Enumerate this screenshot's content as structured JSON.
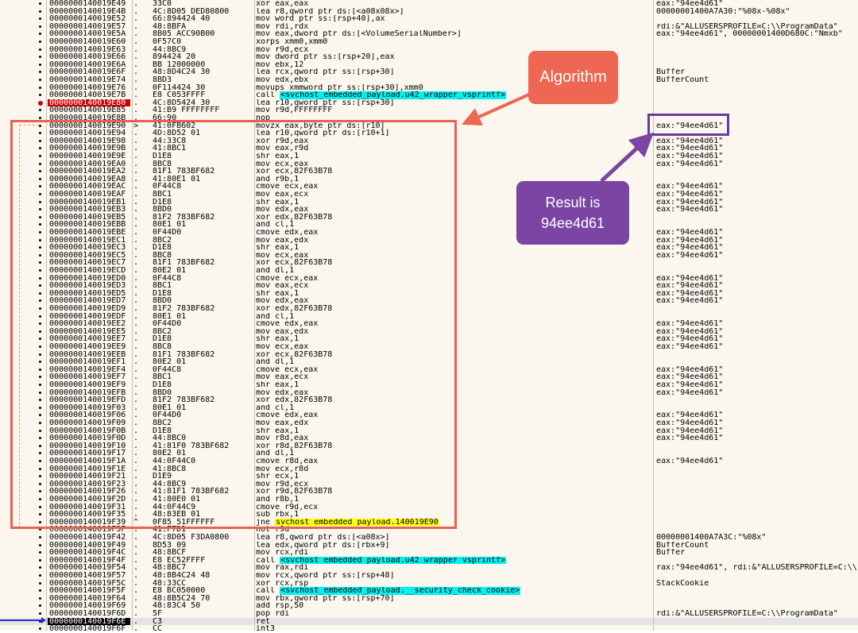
{
  "annotations": {
    "algorithm_label": "Algorithm",
    "result_line1": "Result is",
    "result_line2": "94ee4d61",
    "colors": {
      "algorithm": "#ee6752",
      "result": "#7a45a3",
      "call_highlight": "#00f0f0",
      "jump_highlight": "#ffff00",
      "breakpoint": "#cc0000"
    }
  },
  "rows": [
    {
      "addr": "0000000140019E49",
      "mark": ".",
      "bytes": "33C0",
      "instr": "xor eax,eax",
      "cmt": "eax:\"94ee4d61\""
    },
    {
      "addr": "0000000140019E4B",
      "mark": ".",
      "bytes": "4C:8D05 DED80800",
      "instr": "lea r8,qword ptr ds:[<a08x08x>]",
      "cmt": "00000001400A7A30:\"%08x-%08x\""
    },
    {
      "addr": "0000000140019E52",
      "mark": ".",
      "bytes": "66:894424 40",
      "instr": "mov word ptr ss:[rsp+40],ax",
      "cmt": ""
    },
    {
      "addr": "0000000140019E57",
      "mark": ".",
      "bytes": "48:8BFA",
      "instr": "mov rdi,rdx",
      "cmt": "rdi:&\"ALLUSERSPROFILE=C:\\\\ProgramData\""
    },
    {
      "addr": "0000000140019E5A",
      "mark": ".",
      "bytes": "8B05 ACC90B00",
      "instr": "mov eax,dword ptr ds:[<VolumeSerialNumber>]",
      "cmt": "eax:\"94ee4d61\", 00000001400D680C:\"Nmxb\""
    },
    {
      "addr": "0000000140019E60",
      "mark": ".",
      "bytes": "0F57C0",
      "instr": "xorps xmm0,xmm0",
      "cmt": ""
    },
    {
      "addr": "0000000140019E63",
      "mark": ".",
      "bytes": "44:8BC9",
      "instr": "mov r9d,ecx",
      "cmt": ""
    },
    {
      "addr": "0000000140019E66",
      "mark": ".",
      "bytes": "894424 20",
      "instr": "mov dword ptr ss:[rsp+20],eax",
      "cmt": ""
    },
    {
      "addr": "0000000140019E6A",
      "mark": ".",
      "bytes": "BB 12000000",
      "instr": "mov ebx,12",
      "cmt": ""
    },
    {
      "addr": "0000000140019E6F",
      "mark": ".",
      "bytes": "48:8D4C24 30",
      "instr": "lea rcx,qword ptr ss:[rsp+30]",
      "cmt": "Buffer"
    },
    {
      "addr": "0000000140019E74",
      "mark": ".",
      "bytes": "8BD3",
      "instr": "mov edx,ebx",
      "cmt": "BufferCount"
    },
    {
      "addr": "0000000140019E76",
      "mark": ".",
      "bytes": "0F114424 30",
      "instr": "movups xmmword ptr ss:[rsp+30],xmm0",
      "cmt": ""
    },
    {
      "addr": "0000000140019E7B",
      "mark": ".",
      "bytes": "E8 C053FFFF",
      "instr": "call <svchost_embedded_payload.u42_wrapper_vsprintf>",
      "cmt": ""
    },
    {
      "addr": "0000000140019E80",
      "mark": ".",
      "bytes": "4C:8D5424 30",
      "instr": "lea r10,qword ptr ss:[rsp+30]",
      "cmt": ""
    },
    {
      "addr": "0000000140019E85",
      "mark": ".",
      "bytes": "41:B9 FFFFFFFF",
      "instr": "mov r9d,FFFFFFFF",
      "cmt": ""
    },
    {
      "addr": "0000000140019E8B",
      "mark": ".",
      "bytes": "66:90",
      "instr": "nop",
      "cmt": ""
    },
    {
      "addr": "0000000140019E90",
      "mark": ">",
      "bytes": "41:0FB602",
      "instr": "movzx eax,byte ptr ds:[r10]",
      "cmt": "eax:\"94ee4d61\""
    },
    {
      "addr": "0000000140019E94",
      "mark": ".",
      "bytes": "4D:8D52 01",
      "instr": "lea r10,qword ptr ds:[r10+1]",
      "cmt": ""
    },
    {
      "addr": "0000000140019E98",
      "mark": ".",
      "bytes": "44:33C8",
      "instr": "xor r9d,eax",
      "cmt": "eax:\"94ee4d61\""
    },
    {
      "addr": "0000000140019E9B",
      "mark": ".",
      "bytes": "41:8BC1",
      "instr": "mov eax,r9d",
      "cmt": "eax:\"94ee4d61\""
    },
    {
      "addr": "0000000140019E9E",
      "mark": ".",
      "bytes": "D1E8",
      "instr": "shr eax,1",
      "cmt": "eax:\"94ee4d61\""
    },
    {
      "addr": "0000000140019EA0",
      "mark": ".",
      "bytes": "8BC8",
      "instr": "mov ecx,eax",
      "cmt": "eax:\"94ee4d61\""
    },
    {
      "addr": "0000000140019EA2",
      "mark": ".",
      "bytes": "81F1 783BF682",
      "instr": "xor ecx,82F63B78",
      "cmt": ""
    },
    {
      "addr": "0000000140019EA8",
      "mark": ".",
      "bytes": "41:80E1 01",
      "instr": "and r9b,1",
      "cmt": ""
    },
    {
      "addr": "0000000140019EAC",
      "mark": ".",
      "bytes": "0F44C8",
      "instr": "cmove ecx,eax",
      "cmt": "eax:\"94ee4d61\""
    },
    {
      "addr": "0000000140019EAF",
      "mark": ".",
      "bytes": "8BC1",
      "instr": "mov eax,ecx",
      "cmt": "eax:\"94ee4d61\""
    },
    {
      "addr": "0000000140019EB1",
      "mark": ".",
      "bytes": "D1E8",
      "instr": "shr eax,1",
      "cmt": "eax:\"94ee4d61\""
    },
    {
      "addr": "0000000140019EB3",
      "mark": ".",
      "bytes": "8BD0",
      "instr": "mov edx,eax",
      "cmt": "eax:\"94ee4d61\""
    },
    {
      "addr": "0000000140019EB5",
      "mark": ".",
      "bytes": "81F2 783BF682",
      "instr": "xor edx,82F63B78",
      "cmt": ""
    },
    {
      "addr": "0000000140019EBB",
      "mark": ".",
      "bytes": "80E1 01",
      "instr": "and cl,1",
      "cmt": ""
    },
    {
      "addr": "0000000140019EBE",
      "mark": ".",
      "bytes": "0F44D0",
      "instr": "cmove edx,eax",
      "cmt": "eax:\"94ee4d61\""
    },
    {
      "addr": "0000000140019EC1",
      "mark": ".",
      "bytes": "8BC2",
      "instr": "mov eax,edx",
      "cmt": "eax:\"94ee4d61\""
    },
    {
      "addr": "0000000140019EC3",
      "mark": ".",
      "bytes": "D1E8",
      "instr": "shr eax,1",
      "cmt": "eax:\"94ee4d61\""
    },
    {
      "addr": "0000000140019EC5",
      "mark": ".",
      "bytes": "8BC8",
      "instr": "mov ecx,eax",
      "cmt": "eax:\"94ee4d61\""
    },
    {
      "addr": "0000000140019EC7",
      "mark": ".",
      "bytes": "81F1 783BF682",
      "instr": "xor ecx,82F63B78",
      "cmt": ""
    },
    {
      "addr": "0000000140019ECD",
      "mark": ".",
      "bytes": "80E2 01",
      "instr": "and dl,1",
      "cmt": ""
    },
    {
      "addr": "0000000140019ED0",
      "mark": ".",
      "bytes": "0F44C8",
      "instr": "cmove ecx,eax",
      "cmt": "eax:\"94ee4d61\""
    },
    {
      "addr": "0000000140019ED3",
      "mark": ".",
      "bytes": "8BC1",
      "instr": "mov eax,ecx",
      "cmt": "eax:\"94ee4d61\""
    },
    {
      "addr": "0000000140019ED5",
      "mark": ".",
      "bytes": "D1E8",
      "instr": "shr eax,1",
      "cmt": "eax:\"94ee4d61\""
    },
    {
      "addr": "0000000140019ED7",
      "mark": ".",
      "bytes": "8BD0",
      "instr": "mov edx,eax",
      "cmt": "eax:\"94ee4d61\""
    },
    {
      "addr": "0000000140019ED9",
      "mark": ".",
      "bytes": "81F2 783BF682",
      "instr": "xor edx,82F63B78",
      "cmt": ""
    },
    {
      "addr": "0000000140019EDF",
      "mark": ".",
      "bytes": "80E1 01",
      "instr": "and cl,1",
      "cmt": ""
    },
    {
      "addr": "0000000140019EE2",
      "mark": ".",
      "bytes": "0F44D0",
      "instr": "cmove edx,eax",
      "cmt": "eax:\"94ee4d61\""
    },
    {
      "addr": "0000000140019EE5",
      "mark": ".",
      "bytes": "8BC2",
      "instr": "mov eax,edx",
      "cmt": "eax:\"94ee4d61\""
    },
    {
      "addr": "0000000140019EE7",
      "mark": ".",
      "bytes": "D1E8",
      "instr": "shr eax,1",
      "cmt": "eax:\"94ee4d61\""
    },
    {
      "addr": "0000000140019EE9",
      "mark": ".",
      "bytes": "8BC8",
      "instr": "mov ecx,eax",
      "cmt": "eax:\"94ee4d61\""
    },
    {
      "addr": "0000000140019EEB",
      "mark": ".",
      "bytes": "81F1 783BF682",
      "instr": "xor ecx,82F63B78",
      "cmt": ""
    },
    {
      "addr": "0000000140019EF1",
      "mark": ".",
      "bytes": "80E2 01",
      "instr": "and dl,1",
      "cmt": ""
    },
    {
      "addr": "0000000140019EF4",
      "mark": ".",
      "bytes": "0F44C8",
      "instr": "cmove ecx,eax",
      "cmt": "eax:\"94ee4d61\""
    },
    {
      "addr": "0000000140019EF7",
      "mark": ".",
      "bytes": "8BC1",
      "instr": "mov eax,ecx",
      "cmt": "eax:\"94ee4d61\""
    },
    {
      "addr": "0000000140019EF9",
      "mark": ".",
      "bytes": "D1E8",
      "instr": "shr eax,1",
      "cmt": "eax:\"94ee4d61\""
    },
    {
      "addr": "0000000140019EFB",
      "mark": ".",
      "bytes": "8BD0",
      "instr": "mov edx,eax",
      "cmt": "eax:\"94ee4d61\""
    },
    {
      "addr": "0000000140019EFD",
      "mark": ".",
      "bytes": "81F2 783BF682",
      "instr": "xor edx,82F63B78",
      "cmt": ""
    },
    {
      "addr": "0000000140019F03",
      "mark": ".",
      "bytes": "80E1 01",
      "instr": "and cl,1",
      "cmt": ""
    },
    {
      "addr": "0000000140019F06",
      "mark": ".",
      "bytes": "0F44D0",
      "instr": "cmove edx,eax",
      "cmt": "eax:\"94ee4d61\""
    },
    {
      "addr": "0000000140019F09",
      "mark": ".",
      "bytes": "8BC2",
      "instr": "mov eax,edx",
      "cmt": "eax:\"94ee4d61\""
    },
    {
      "addr": "0000000140019F0B",
      "mark": ".",
      "bytes": "D1E8",
      "instr": "shr eax,1",
      "cmt": "eax:\"94ee4d61\""
    },
    {
      "addr": "0000000140019F0D",
      "mark": ".",
      "bytes": "44:8BC0",
      "instr": "mov r8d,eax",
      "cmt": "eax:\"94ee4d61\""
    },
    {
      "addr": "0000000140019F10",
      "mark": ".",
      "bytes": "41:81F0 783BF682",
      "instr": "xor r8d,82F63B78",
      "cmt": ""
    },
    {
      "addr": "0000000140019F17",
      "mark": ".",
      "bytes": "80E2 01",
      "instr": "and dl,1",
      "cmt": ""
    },
    {
      "addr": "0000000140019F1A",
      "mark": ".",
      "bytes": "44:0F44C0",
      "instr": "cmove r8d,eax",
      "cmt": "eax:\"94ee4d61\""
    },
    {
      "addr": "0000000140019F1E",
      "mark": ".",
      "bytes": "41:8BC8",
      "instr": "mov ecx,r8d",
      "cmt": ""
    },
    {
      "addr": "0000000140019F21",
      "mark": ".",
      "bytes": "D1E9",
      "instr": "shr ecx,1",
      "cmt": ""
    },
    {
      "addr": "0000000140019F23",
      "mark": ".",
      "bytes": "44:8BC9",
      "instr": "mov r9d,ecx",
      "cmt": ""
    },
    {
      "addr": "0000000140019F26",
      "mark": ".",
      "bytes": "41:81F1 783BF682",
      "instr": "xor r9d,82F63B78",
      "cmt": ""
    },
    {
      "addr": "0000000140019F2D",
      "mark": ".",
      "bytes": "41:80E0 01",
      "instr": "and r8b,1",
      "cmt": ""
    },
    {
      "addr": "0000000140019F31",
      "mark": ".",
      "bytes": "44:0F44C9",
      "instr": "cmove r9d,ecx",
      "cmt": ""
    },
    {
      "addr": "0000000140019F35",
      "mark": ".",
      "bytes": "48:83EB 01",
      "instr": "sub rbx,1",
      "cmt": ""
    },
    {
      "addr": "0000000140019F39",
      "mark": "^",
      "bytes": "0F85 51FFFFFF",
      "instr": "jne svchost_embedded_payload.140019E90",
      "cmt": ""
    },
    {
      "addr": "0000000140019F3F",
      "mark": ".",
      "bytes": "41:F7D1",
      "instr": "not r9d",
      "cmt": ""
    },
    {
      "addr": "0000000140019F42",
      "mark": ".",
      "bytes": "4C:8D05 F3DA0800",
      "instr": "lea r8,qword ptr ds:[<a08x>]",
      "cmt": "00000001400A7A3C:\"%08x\""
    },
    {
      "addr": "0000000140019F49",
      "mark": ".",
      "bytes": "8D53 09",
      "instr": "lea edx,qword ptr ds:[rbx+9]",
      "cmt": "BufferCount"
    },
    {
      "addr": "0000000140019F4C",
      "mark": ".",
      "bytes": "48:8BCF",
      "instr": "mov rcx,rdi",
      "cmt": "Buffer"
    },
    {
      "addr": "0000000140019F4F",
      "mark": ".",
      "bytes": "E8 EC52FFFF",
      "instr": "call <svchost_embedded_payload.u42_wrapper_vsprintf>",
      "cmt": ""
    },
    {
      "addr": "0000000140019F54",
      "mark": ".",
      "bytes": "48:8BC7",
      "instr": "mov rax,rdi",
      "cmt": "rax:\"94ee4d61\", rdi:&\"ALLUSERSPROFILE=C:\\\\"
    },
    {
      "addr": "0000000140019F57",
      "mark": ".",
      "bytes": "48:8B4C24 48",
      "instr": "mov rcx,qword ptr ss:[rsp+48]",
      "cmt": ""
    },
    {
      "addr": "0000000140019F5C",
      "mark": ".",
      "bytes": "48:33CC",
      "instr": "xor rcx,rsp",
      "cmt": "StackCookie"
    },
    {
      "addr": "0000000140019F5F",
      "mark": ".",
      "bytes": "E8 BC050000",
      "instr": "call <svchost_embedded_payload.__security_check_cookie>",
      "cmt": ""
    },
    {
      "addr": "0000000140019F64",
      "mark": ".",
      "bytes": "48:8B5C24 70",
      "instr": "mov rbx,qword ptr ss:[rsp+70]",
      "cmt": ""
    },
    {
      "addr": "0000000140019F69",
      "mark": ".",
      "bytes": "48:83C4 50",
      "instr": "add rsp,50",
      "cmt": ""
    },
    {
      "addr": "0000000140019F6D",
      "mark": ".",
      "bytes": "5F",
      "instr": "pop rdi",
      "cmt": "rdi:&\"ALLUSERSPROFILE=C:\\\\ProgramData\""
    },
    {
      "addr": "0000000140019F6E",
      "mark": ".",
      "bytes": "C3",
      "instr": "ret",
      "cmt": ""
    },
    {
      "addr": "0000000140019F6F",
      "mark": ".",
      "bytes": "CC",
      "instr": "int3",
      "cmt": ""
    }
  ]
}
